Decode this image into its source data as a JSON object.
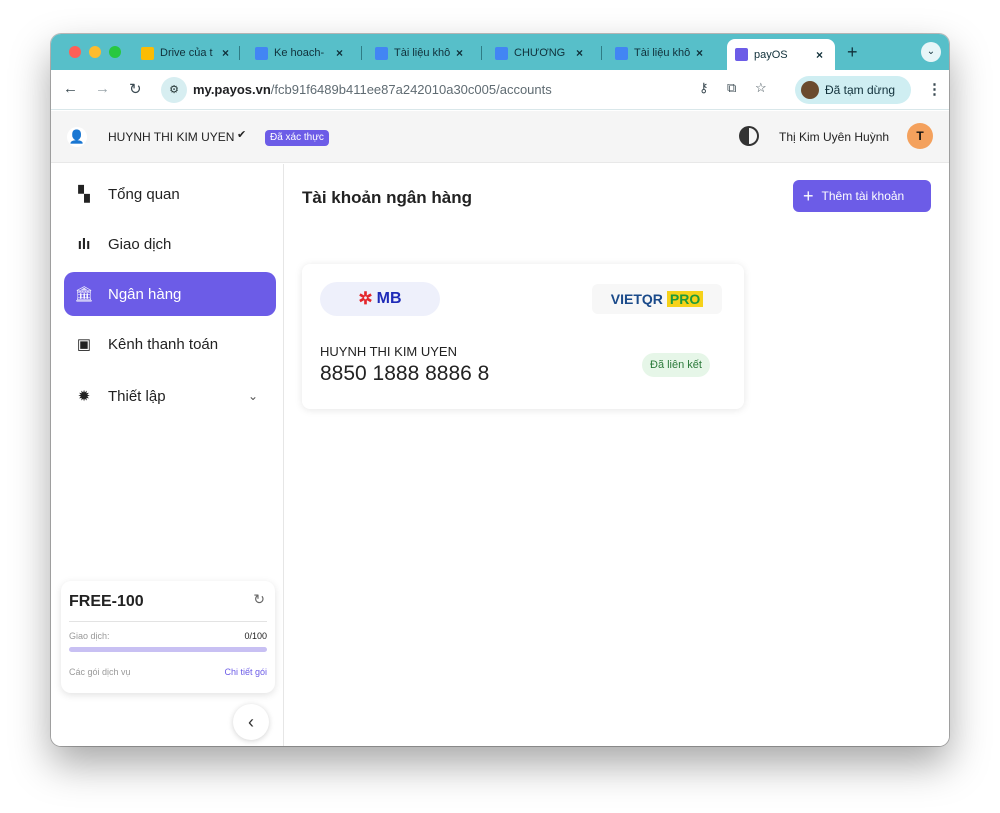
{
  "browser": {
    "tabs": [
      {
        "label": "Drive của t",
        "favicon_color": "#fbbc04"
      },
      {
        "label": "Ke hoach-",
        "favicon_color": "#4285f4"
      },
      {
        "label": "Tài liệu khô",
        "favicon_color": "#4285f4"
      },
      {
        "label": "CHƯƠNG",
        "favicon_color": "#4285f4"
      },
      {
        "label": "Tài liệu khô",
        "favicon_color": "#4285f4"
      },
      {
        "label": "payOS",
        "favicon_color": "#6c5ce7"
      }
    ],
    "url_domain": "my.payos.vn",
    "url_path": "/fcb91f6489b411ee87a242010a30c005/accounts",
    "paused_label": "Đã tạm dừng"
  },
  "header": {
    "account_name": "HUYNH THI KIM UYEN",
    "verified_badge": "Đã xác thực",
    "profile_name": "Thị Kim Uyên Huỳnh",
    "profile_initial": "T"
  },
  "sidebar": {
    "items": [
      {
        "label": "Tổng quan",
        "icon": "dashboard-icon"
      },
      {
        "label": "Giao dịch",
        "icon": "bar-chart-icon"
      },
      {
        "label": "Ngân hàng",
        "icon": "bank-icon"
      },
      {
        "label": "Kênh thanh toán",
        "icon": "wallet-icon"
      },
      {
        "label": "Thiết lập",
        "icon": "gear-icon"
      }
    ],
    "plan": {
      "name": "FREE-100",
      "tx_label": "Giao dịch:",
      "tx_value": "0/100",
      "tx_used_fraction": 0.0,
      "services_label": "Các gói dịch vụ",
      "detail_link": "Chi tiết gói"
    }
  },
  "main": {
    "title": "Tài khoản ngân hàng",
    "add_button": "Thêm tài khoản",
    "account": {
      "bank_logo": "MB",
      "qr_brand_a": "VIETQR",
      "qr_brand_b": "PRO",
      "holder": "HUYNH THI KIM UYEN",
      "number": "8850 1888 8886 8",
      "status": "Đã liên kết"
    }
  },
  "colors": {
    "accent": "#6c5ce7",
    "tabbar": "#57bfc9",
    "linked_bg": "#e6f6e8",
    "linked_text": "#2b7a3a"
  }
}
